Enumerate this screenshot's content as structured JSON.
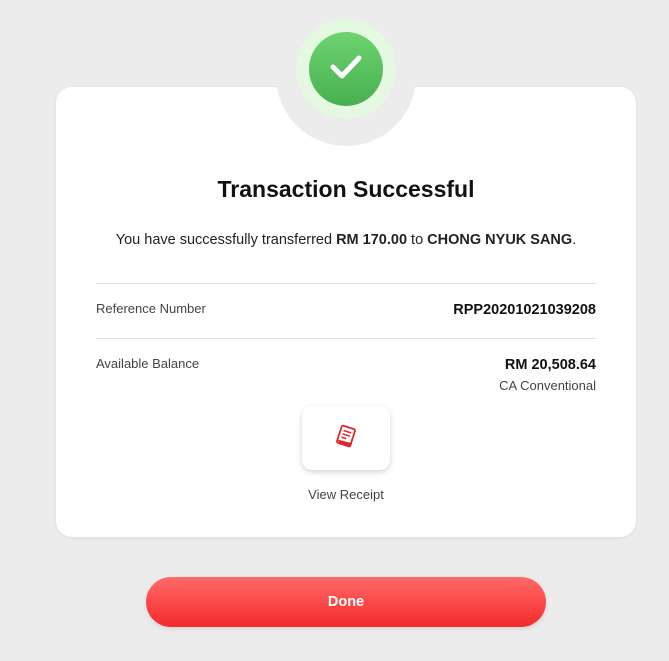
{
  "status": {
    "title": "Transaction Successful",
    "message_prefix": "You have successfully transferred ",
    "amount": "RM 170.00",
    "message_mid": " to ",
    "recipient": "CHONG NYUK SANG",
    "message_suffix": ".",
    "icon": "check-icon",
    "success_color": "#4fb654"
  },
  "details": {
    "reference": {
      "label": "Reference Number",
      "value": "RPP20201021039208"
    },
    "balance": {
      "label": "Available Balance",
      "value": "RM 20,508.64",
      "account": "CA Conventional"
    }
  },
  "receipt": {
    "label": "View Receipt",
    "icon": "receipt-icon",
    "icon_color": "#e0262b"
  },
  "done": {
    "label": "Done",
    "color": "#f73333"
  }
}
